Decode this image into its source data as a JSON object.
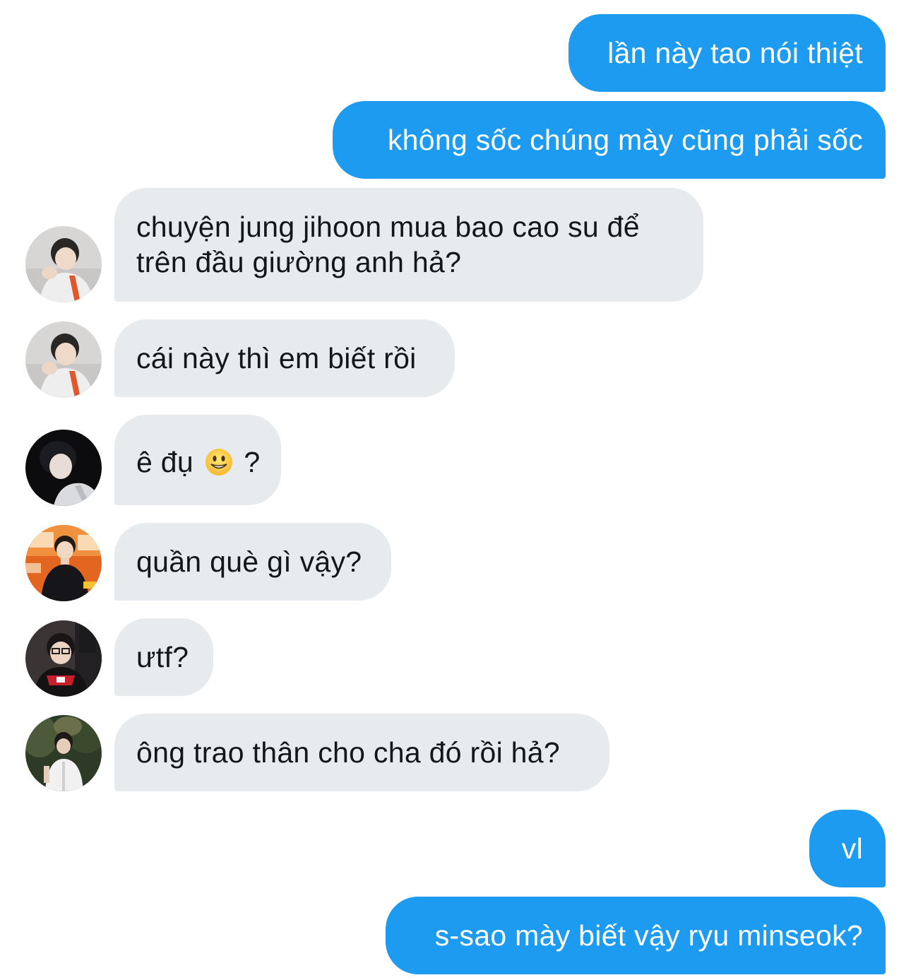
{
  "conversation": {
    "messages": [
      {
        "direction": "outgoing",
        "text": "lần này tao nói thiệt"
      },
      {
        "direction": "outgoing",
        "text": "không sốc chúng mày cũng phải sốc"
      },
      {
        "direction": "incoming",
        "sender_avatar": "avatar-a",
        "lines": [
          "chuyện jung jihoon mua bao cao su để",
          "trên đầu giường anh hả?"
        ]
      },
      {
        "direction": "incoming",
        "sender_avatar": "avatar-a",
        "text": "cái này thì em biết rồi"
      },
      {
        "direction": "incoming",
        "sender_avatar": "avatar-b",
        "text_before": "ê đụ",
        "emoji": "grinning-face-emoji",
        "text_after": "?"
      },
      {
        "direction": "incoming",
        "sender_avatar": "avatar-c",
        "text": "quần què gì vậy?"
      },
      {
        "direction": "incoming",
        "sender_avatar": "avatar-d",
        "text": "ưtf?"
      },
      {
        "direction": "incoming",
        "sender_avatar": "avatar-e",
        "text": "ông trao thân cho cha đó rồi hả?"
      },
      {
        "direction": "outgoing",
        "text": "vl"
      },
      {
        "direction": "outgoing",
        "text": "s-sao mày biết vậy ryu minseok?"
      }
    ]
  },
  "colors": {
    "outgoing_bubble": "#1d9bf0",
    "incoming_bubble": "#e7ebee",
    "incoming_text": "#14171a",
    "outgoing_text": "#ffffff",
    "background": "#ffffff"
  }
}
